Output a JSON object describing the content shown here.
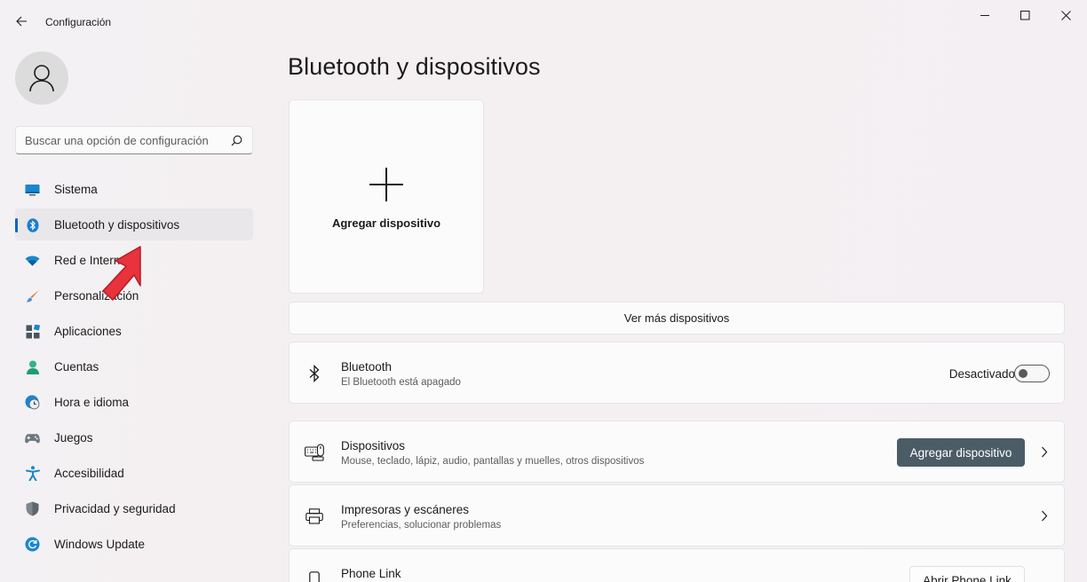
{
  "window": {
    "app_title": "Configuración"
  },
  "sidebar": {
    "search_placeholder": "Buscar una opción de configuración",
    "items": [
      {
        "label": "Sistema",
        "icon": "monitor-icon"
      },
      {
        "label": "Bluetooth y dispositivos",
        "icon": "bluetooth-icon",
        "active": true
      },
      {
        "label": "Red e Internet",
        "icon": "wifi-icon"
      },
      {
        "label": "Personalización",
        "icon": "brush-icon"
      },
      {
        "label": "Aplicaciones",
        "icon": "apps-icon"
      },
      {
        "label": "Cuentas",
        "icon": "person-icon"
      },
      {
        "label": "Hora e idioma",
        "icon": "clock-globe-icon"
      },
      {
        "label": "Juegos",
        "icon": "gamepad-icon"
      },
      {
        "label": "Accesibilidad",
        "icon": "accessibility-icon"
      },
      {
        "label": "Privacidad y seguridad",
        "icon": "shield-icon"
      },
      {
        "label": "Windows Update",
        "icon": "update-icon"
      }
    ]
  },
  "main": {
    "title": "Bluetooth y dispositivos",
    "add_tile_label": "Agregar dispositivo",
    "more_devices_label": "Ver más dispositivos",
    "bluetooth": {
      "title": "Bluetooth",
      "subtitle": "El Bluetooth está apagado",
      "toggle_state_label": "Desactivado",
      "enabled": false
    },
    "devices": {
      "title": "Dispositivos",
      "subtitle": "Mouse, teclado, lápiz, audio, pantallas y muelles, otros dispositivos",
      "button_label": "Agregar dispositivo"
    },
    "printers": {
      "title": "Impresoras y escáneres",
      "subtitle": "Preferencias, solucionar problemas"
    },
    "phone_link": {
      "title": "Phone Link",
      "button_label": "Abrir Phone Link"
    }
  },
  "colors": {
    "accent": "#0067c0",
    "button_dark": "#4c5c67",
    "annotation_arrow": "#e8323c"
  }
}
